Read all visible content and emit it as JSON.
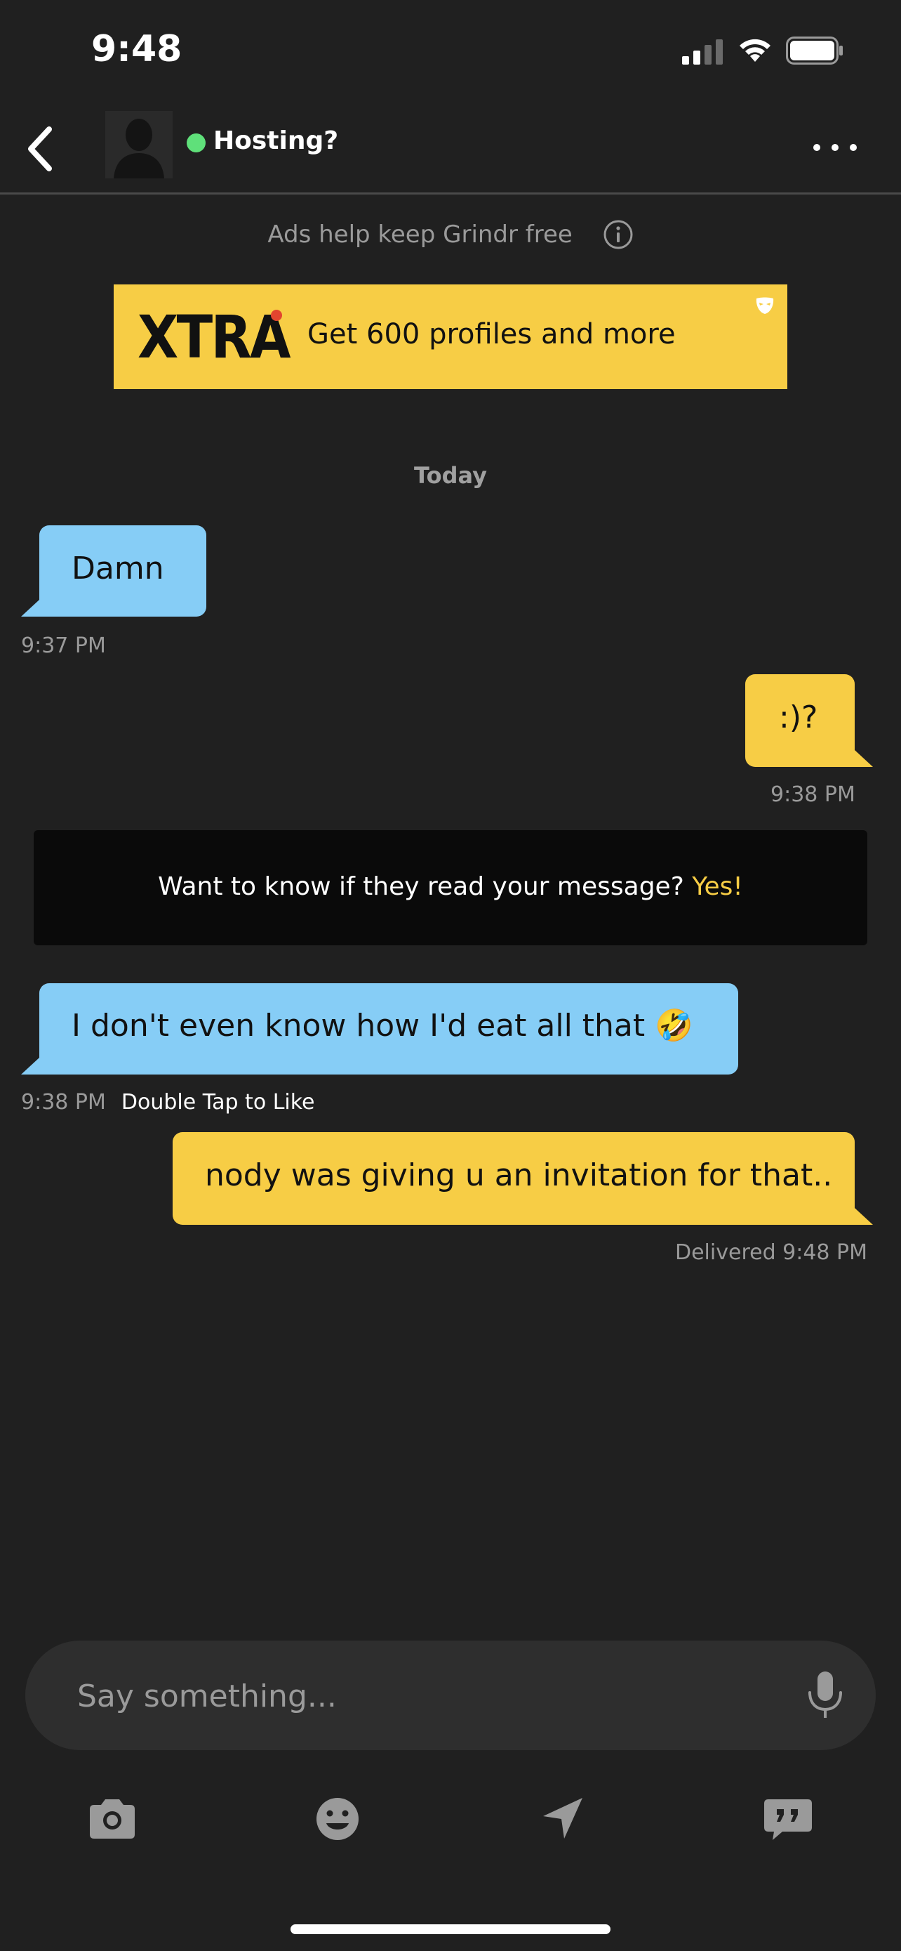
{
  "status_bar": {
    "time": "9:48"
  },
  "header": {
    "profile_name": "Hosting?"
  },
  "ads_notice": "Ads help keep Grindr free",
  "banner": {
    "logo": "XTRA",
    "text": "Get 600 profiles and more"
  },
  "day_label": "Today",
  "messages": [
    {
      "direction": "incoming",
      "text": "Damn",
      "time": "9:37 PM"
    },
    {
      "direction": "outgoing",
      "text": ":)?",
      "time": "9:38 PM"
    },
    {
      "direction": "incoming",
      "text": "I don't even know how I'd eat all that 🤣",
      "time": "9:38 PM",
      "hint": "Double Tap to Like"
    },
    {
      "direction": "outgoing",
      "text": "nody was giving u an invitation for that..",
      "time": "Delivered 9:48 PM"
    }
  ],
  "read_prompt": {
    "text": "Want to know if they read your message?",
    "action": "Yes!"
  },
  "composer": {
    "placeholder": "Say something..."
  },
  "toolbar": [
    "camera-icon",
    "emoji-icon",
    "location-icon",
    "saved-phrases-icon"
  ],
  "colors": {
    "background": "#202020",
    "incoming_bubble": "#86cdf6",
    "outgoing_bubble": "#f7cd45",
    "accent": "#f7cd45",
    "online": "#5fe07a"
  }
}
